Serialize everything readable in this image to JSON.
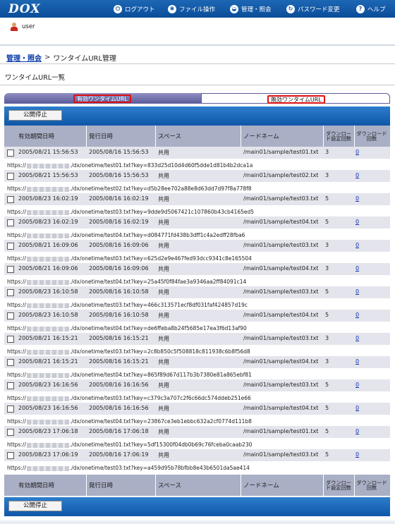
{
  "header": {
    "logo": "DOX",
    "nav": [
      {
        "label": "ログアウト",
        "icon": "logout-icon",
        "glyph": "⏻"
      },
      {
        "label": "ファイル操作",
        "icon": "file-ops-icon",
        "glyph": "✱"
      },
      {
        "label": "管理・照会",
        "icon": "admin-icon",
        "glyph": "◒"
      },
      {
        "label": "パスワード変更",
        "icon": "password-icon",
        "glyph": "↻"
      },
      {
        "label": "ヘルプ",
        "icon": "help-icon",
        "glyph": "?"
      }
    ]
  },
  "user": {
    "name": "user"
  },
  "breadcrumb": {
    "parent": "管理・照会",
    "separator": ">",
    "current": "ワンタイムURL管理"
  },
  "list_title": "ワンタイムURL一覧",
  "tabs": {
    "active": "有効ワンタイムURL",
    "inactive": "無効ワンタイムURL"
  },
  "actions": {
    "stop_label": "公開停止"
  },
  "columns": {
    "expiry": "有効期間日時",
    "issued": "発行日時",
    "space": "スペース",
    "node": "ノードネーム",
    "dl_limit": "ダウンロード設定回数",
    "dl_count": "ダウンロード回数"
  },
  "url_prefix": "https://",
  "rows": [
    {
      "expiry": "2005/08/21 15:56:53",
      "issued": "2005/08/16 15:56:53",
      "space": "共用",
      "node": "/main01/sample/test01.txt",
      "limit": "3",
      "count": "0",
      "url_tail": "./dx/onetime/test01.txt?key=833d25d10d4d60f5dde1d81b4b2dca1a"
    },
    {
      "expiry": "2005/08/21 15:56:53",
      "issued": "2005/08/16 15:56:53",
      "space": "共用",
      "node": "/main01/sample/test02.txt",
      "limit": "3",
      "count": "0",
      "url_tail": "./dx/onetime/test02.txt?key=d5b28ee702a88e8d63dd7d97f8a778f8"
    },
    {
      "expiry": "2005/08/23 16:02:19",
      "issued": "2005/08/16 16:02:19",
      "space": "共用",
      "node": "/main01/sample/test03.txt",
      "limit": "5",
      "count": "0",
      "url_tail": "./dx/onetime/test03.txt?key=9dde9d5067421c107860b43cb4165ed5"
    },
    {
      "expiry": "2005/08/23 16:02:19",
      "issued": "2005/08/16 16:02:19",
      "space": "共用",
      "node": "/main01/sample/test04.txt",
      "limit": "5",
      "count": "0",
      "url_tail": "./dx/onetime/test04.txt?key=d084771fd438b3dff1c4a2edff28fba6"
    },
    {
      "expiry": "2005/08/21 16:09:06",
      "issued": "2005/08/16 16:09:06",
      "space": "共用",
      "node": "/main01/sample/test03.txt",
      "limit": "3",
      "count": "0",
      "url_tail": "./dx/onetime/test03.txt?key=625d2e9e467fed93dcc9341c8e165504"
    },
    {
      "expiry": "2005/08/21 16:09:06",
      "issued": "2005/08/16 16:09:06",
      "space": "共用",
      "node": "/main01/sample/test04.txt",
      "limit": "3",
      "count": "0",
      "url_tail": "./dx/onetime/test04.txt?key=25a45f0f84fae3a9346aa2ff84091c14"
    },
    {
      "expiry": "2005/08/23 16:10:58",
      "issued": "2005/08/16 16:10:58",
      "space": "共用",
      "node": "/main01/sample/test03.txt",
      "limit": "5",
      "count": "0",
      "url_tail": "./dx/onetime/test03.txt?key=466c313571ecf8df031faf424857d19c"
    },
    {
      "expiry": "2005/08/23 16:10:58",
      "issued": "2005/08/16 16:10:58",
      "space": "共用",
      "node": "/main01/sample/test04.txt",
      "limit": "5",
      "count": "0",
      "url_tail": "./dx/onetime/test04.txt?key=de6ffeba8b24f5685e17ea3f6d13af90"
    },
    {
      "expiry": "2005/08/21 16:15:21",
      "issued": "2005/08/16 16:15:21",
      "space": "共用",
      "node": "/main01/sample/test03.txt",
      "limit": "3",
      "count": "0",
      "url_tail": "./dx/onetime/test03.txt?key=2c8b850c5f508818c811938c6b8f56d8"
    },
    {
      "expiry": "2005/08/21 16:15:21",
      "issued": "2005/08/16 16:15:21",
      "space": "共用",
      "node": "/main01/sample/test04.txt",
      "limit": "3",
      "count": "0",
      "url_tail": "./dx/onetime/test04.txt?key=865f89d67d117b3b7380e81a865ebf81"
    },
    {
      "expiry": "2005/08/23 16:16:56",
      "issued": "2005/08/16 16:16:56",
      "space": "共用",
      "node": "/main01/sample/test03.txt",
      "limit": "5",
      "count": "0",
      "url_tail": "./dx/onetime/test03.txt?key=c379c3a707c2f6c66dc574ddeb251e66"
    },
    {
      "expiry": "2005/08/23 16:16:56",
      "issued": "2005/08/16 16:16:56",
      "space": "共用",
      "node": "/main01/sample/test04.txt",
      "limit": "5",
      "count": "0",
      "url_tail": "./dx/onetime/test04.txt?key=23867ce3eb1ebbc632a2cf0774d111b8"
    },
    {
      "expiry": "2005/08/23 17:06:18",
      "issued": "2005/08/16 17:06:18",
      "space": "共用",
      "node": "/main01/sample/test01.txt",
      "limit": "5",
      "count": "0",
      "url_tail": "./dx/onetime/test01.txt?key=5df15300f04db0b69c76fceba0caab230"
    },
    {
      "expiry": "2005/08/23 17:06:19",
      "issued": "2005/08/16 17:06:19",
      "space": "共用",
      "node": "/main01/sample/test03.txt",
      "limit": "5",
      "count": "0",
      "url_tail": "./dx/onetime/test03.txt?key=a459d95b78bfbb8e43b6501da5ae414"
    }
  ]
}
